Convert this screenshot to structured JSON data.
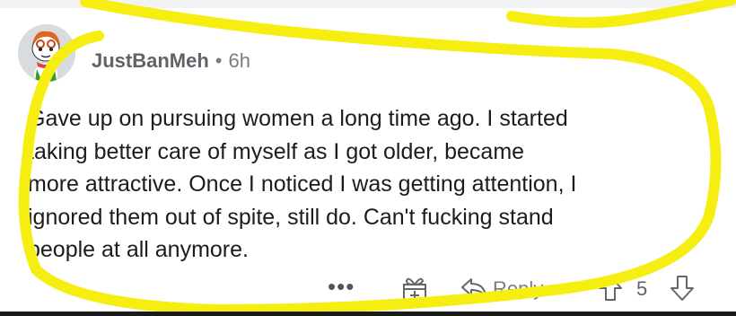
{
  "comment": {
    "author": "JustBanMeh",
    "separator": "•",
    "time": "6h",
    "lines": [
      "Gave up on pursuing women a long time ago. I started",
      "taking better care of myself as I got older, became",
      "more attractive. Once I noticed I was getting attention, I",
      "ignored them out of spite, still do. Can't fucking stand",
      "people at all anymore."
    ]
  },
  "actions": {
    "more": "•••",
    "reply": "Reply",
    "score": "5"
  },
  "icons": {
    "award": "award-gift-icon",
    "reply": "reply-arrow-icon",
    "upvote": "upvote-arrow-icon",
    "downvote": "downvote-arrow-icon"
  },
  "colors": {
    "annotation": "#f5ee10",
    "text": "#1c1c1c",
    "meta": "#7c7c7c"
  }
}
